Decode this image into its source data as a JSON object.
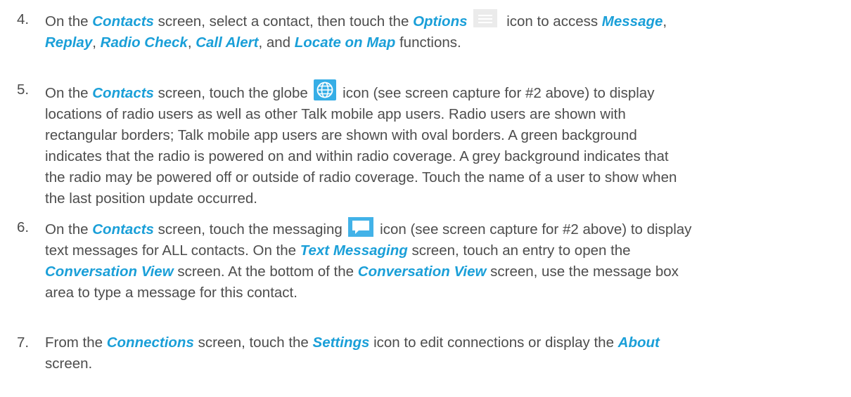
{
  "items": [
    {
      "number": "4.",
      "parts": [
        "On the ",
        "Contacts",
        " screen, select a contact, then touch the ",
        "Options",
        " icon to access ",
        "Message",
        ",",
        "Replay",
        ", ",
        "Radio Check",
        ", ",
        "Call Alert",
        ", and ",
        "Locate on Map",
        " functions."
      ],
      "icon": "options-menu-icon"
    },
    {
      "number": "5.",
      "lead": "On the ",
      "keyword": "Contacts",
      "before_icon": " screen, touch the globe ",
      "icon": "globe-icon",
      "after_icon": " icon (see screen capture for #2 above) to display",
      "lines": [
        "locations of radio users as well as other Talk mobile app users.  Radio users are shown with",
        "rectangular borders; Talk mobile app users are shown with oval borders.  A green background",
        "indicates that the radio is powered on and within radio coverage.  A grey background indicates that",
        "the radio may be powered off or outside of radio coverage.  Touch the name of a user to show when",
        "the last position update occurred."
      ]
    },
    {
      "number": "6.",
      "parts": [
        "On the ",
        "Contacts",
        " screen, touch the messaging ",
        " icon (see screen capture for #2 above) to display",
        "text messages for ALL contacts.  On the ",
        "Text Messaging",
        " screen, touch an entry to open the",
        "Conversation View",
        " screen.  At the bottom of the ",
        "Conversation View",
        " screen, use the message box",
        "area to type a message for this contact."
      ],
      "icon": "message-bubble-icon"
    },
    {
      "number": "7.",
      "parts": [
        "From the ",
        "Connections",
        " screen, touch the ",
        "Settings",
        " icon to edit connections or display the ",
        "About",
        "screen."
      ]
    }
  ],
  "colors": {
    "text": "#4d4d4d",
    "keyword": "#1a9fd8",
    "options_icon": "#ebebeb",
    "globe_bg": "#36aee6",
    "message_bg": "#42b2e8"
  }
}
